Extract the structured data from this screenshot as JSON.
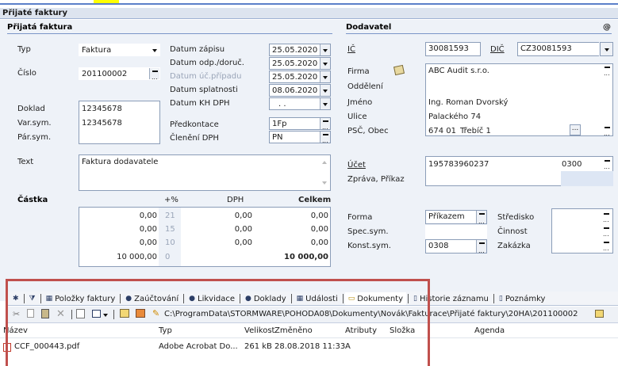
{
  "window": {
    "title": "Přijaté faktury"
  },
  "left": {
    "section_title": "Přijatá faktura",
    "typ_label": "Typ",
    "typ_value": "Faktura",
    "cislo_label": "Číslo",
    "cislo_value": "201100002",
    "doklad_label": "Doklad",
    "doklad_value": "12345678",
    "varsym_label": "Var.sym.",
    "varsym_value": "12345678",
    "parsym_label": "Pár.sym.",
    "text_label": "Text",
    "text_value": "Faktura dodavatele"
  },
  "dates": [
    {
      "label": "Datum zápisu",
      "value": "25.05.2020",
      "disabled": false
    },
    {
      "label": "Datum odp./doruč.",
      "value": "25.05.2020",
      "disabled": false
    },
    {
      "label": "Datum úč.případu",
      "value": "25.05.2020",
      "disabled": true
    },
    {
      "label": "Datum splatnosti",
      "value": "08.06.2020",
      "disabled": false
    },
    {
      "label": "Datum KH DPH",
      "value": ". .",
      "disabled": false
    }
  ],
  "predkontace": {
    "label": "Předkontace",
    "value": "1Fp"
  },
  "cleneni": {
    "label": "Členění DPH",
    "value": "PN"
  },
  "amount": {
    "section_label": "Částka",
    "headers": {
      "pct": "+%",
      "dph": "DPH",
      "total": "Celkem"
    },
    "rows": [
      {
        "base": "0,00",
        "pct": "21",
        "dph": "0,00",
        "total": "0,00"
      },
      {
        "base": "0,00",
        "pct": "15",
        "dph": "0,00",
        "total": "0,00"
      },
      {
        "base": "0,00",
        "pct": "10",
        "dph": "0,00",
        "total": "0,00"
      },
      {
        "base": "10 000,00",
        "pct": "0",
        "dph": "",
        "total": "10 000,00"
      }
    ]
  },
  "supplier": {
    "section_title": "Dodavatel",
    "at_symbol": "@",
    "ic_label": "IČ",
    "ic_value": "30081593",
    "dic_label": "DIČ",
    "dic_value": "CZ30081593",
    "firma_label": "Firma",
    "firma_value": "ABC Audit s.r.o.",
    "oddeleni_label": "Oddělení",
    "jmeno_label": "Jméno",
    "jmeno_value": "Ing. Roman Dvorský",
    "ulice_label": "Ulice",
    "ulice_value": "Palackého 74",
    "psc_label": "PSČ, Obec",
    "psc_value": "674 01",
    "obec_value": "Třebíč 1",
    "ucet_label": "Účet",
    "ucet_value": "195783960237",
    "bank_code": "0300",
    "zprava_label": "Zpráva, Příkaz",
    "forma_label": "Forma",
    "forma_value": "Příkazem",
    "spec_label": "Spec.sym.",
    "konst_label": "Konst.sym.",
    "konst_value": "0308",
    "stredisko_label": "Středisko",
    "cinnost_label": "Činnost",
    "zakazka_label": "Zakázka"
  },
  "tabs": [
    {
      "label": "",
      "icon": "asterisk-icon"
    },
    {
      "label": "",
      "icon": "filter-icon"
    },
    {
      "label": "Položky faktury",
      "icon": "table-icon"
    },
    {
      "label": "Zaúčtování",
      "icon": "info-icon"
    },
    {
      "label": "Likvidace",
      "icon": "circle-icon"
    },
    {
      "label": "Doklady",
      "icon": "circle-icon"
    },
    {
      "label": "Události",
      "icon": "table-icon"
    },
    {
      "label": "Dokumenty",
      "icon": "folder-icon"
    },
    {
      "label": "Historie záznamu",
      "icon": "page-icon"
    },
    {
      "label": "Poznámky",
      "icon": "page-icon"
    }
  ],
  "toolbar": {
    "path": "C:\\ProgramData\\STORMWARE\\POHODA08\\Dokumenty\\Novák\\Fakturace\\Přijaté faktury\\20HA\\201100002"
  },
  "files": {
    "columns": [
      "Název",
      "Typ",
      "Velikost",
      "Změněno",
      "Atributy",
      "Složka",
      "Agenda"
    ],
    "rows": [
      {
        "name": "CCF_000443.pdf",
        "type": "Adobe Acrobat Do...",
        "size": "261 kB",
        "modified": "28.08.2018 11:33",
        "attr": "A",
        "folder": "",
        "agenda": ""
      }
    ]
  },
  "colors": {
    "accent": "#c0504d",
    "header_blue": "#2f5597",
    "disabled": "#9aa5b8"
  }
}
